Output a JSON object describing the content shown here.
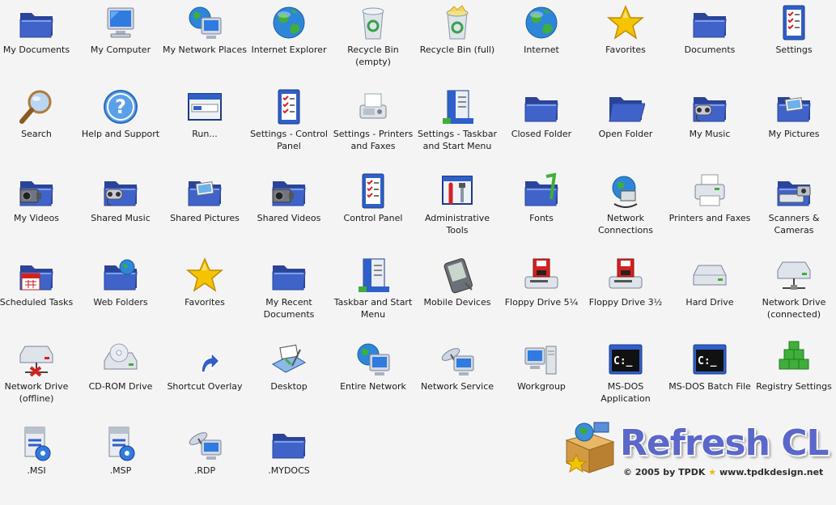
{
  "icons": [
    {
      "label": "My Documents",
      "icon": "folder-icon"
    },
    {
      "label": "My Computer",
      "icon": "monitor-icon"
    },
    {
      "label": "My Network Places",
      "icon": "network-places-icon"
    },
    {
      "label": "Internet Explorer",
      "icon": "globe-icon"
    },
    {
      "label": "Recycle Bin (empty)",
      "icon": "recycle-bin-empty-icon"
    },
    {
      "label": "Recycle Bin (full)",
      "icon": "recycle-bin-full-icon"
    },
    {
      "label": "Internet",
      "icon": "globe-icon"
    },
    {
      "label": "Favorites",
      "icon": "star-icon"
    },
    {
      "label": "Documents",
      "icon": "folder-icon"
    },
    {
      "label": "Settings",
      "icon": "checklist-icon"
    },
    {
      "label": "Search",
      "icon": "magnifier-icon"
    },
    {
      "label": "Help and Support",
      "icon": "help-icon"
    },
    {
      "label": "Run...",
      "icon": "run-window-icon"
    },
    {
      "label": "Settings - Control\nPanel",
      "icon": "checklist-icon"
    },
    {
      "label": "Settings - Printers\nand Faxes",
      "icon": "fax-icon"
    },
    {
      "label": "Settings - Taskbar\nand Start Menu",
      "icon": "taskbar-icon"
    },
    {
      "label": "Closed Folder",
      "icon": "folder-icon"
    },
    {
      "label": "Open Folder",
      "icon": "folder-open-icon"
    },
    {
      "label": "My Music",
      "icon": "music-folder-icon"
    },
    {
      "label": "My Pictures",
      "icon": "pictures-folder-icon"
    },
    {
      "label": "My Videos",
      "icon": "video-folder-icon"
    },
    {
      "label": "Shared Music",
      "icon": "music-folder-icon"
    },
    {
      "label": "Shared Pictures",
      "icon": "pictures-folder-icon"
    },
    {
      "label": "Shared Videos",
      "icon": "video-folder-icon"
    },
    {
      "label": "Control Panel",
      "icon": "checklist-icon"
    },
    {
      "label": "Administrative Tools",
      "icon": "tools-icon"
    },
    {
      "label": "Fonts",
      "icon": "fonts-folder-icon"
    },
    {
      "label": "Network\nConnections",
      "icon": "network-connections-icon"
    },
    {
      "label": "Printers and Faxes",
      "icon": "printer-icon"
    },
    {
      "label": "Scanners &\nCameras",
      "icon": "scanner-icon"
    },
    {
      "label": "Scheduled Tasks",
      "icon": "calendar-folder-icon"
    },
    {
      "label": "Web Folders",
      "icon": "web-folder-icon"
    },
    {
      "label": "Favorites",
      "icon": "star-icon"
    },
    {
      "label": "My Recent\nDocuments",
      "icon": "folder-icon"
    },
    {
      "label": "Taskbar and Start\nMenu",
      "icon": "taskbar-icon"
    },
    {
      "label": "Mobile Devices",
      "icon": "pda-icon"
    },
    {
      "label": "Floppy Drive 5¼",
      "icon": "floppy-drive-icon"
    },
    {
      "label": "Floppy Drive 3½",
      "icon": "floppy-drive-icon"
    },
    {
      "label": "Hard Drive",
      "icon": "hard-drive-icon"
    },
    {
      "label": "Network Drive\n(connected)",
      "icon": "network-drive-icon"
    },
    {
      "label": "Network Drive\n(offline)",
      "icon": "network-drive-offline-icon"
    },
    {
      "label": "CD-ROM Drive",
      "icon": "cdrom-drive-icon"
    },
    {
      "label": "Shortcut Overlay",
      "icon": "shortcut-arrow-icon"
    },
    {
      "label": "Desktop",
      "icon": "desktop-icon"
    },
    {
      "label": "Entire Network",
      "icon": "network-places-icon"
    },
    {
      "label": "Network Service",
      "icon": "network-service-icon"
    },
    {
      "label": "Workgroup",
      "icon": "workgroup-icon"
    },
    {
      "label": "MS-DOS Application",
      "icon": "msdos-icon"
    },
    {
      "label": "MS-DOS Batch File",
      "icon": "msdos-icon"
    },
    {
      "label": "Registry Settings",
      "icon": "registry-icon"
    },
    {
      "label": ".MSI",
      "icon": "msi-icon"
    },
    {
      "label": ".MSP",
      "icon": "msi-icon"
    },
    {
      "label": ".RDP",
      "icon": "network-service-icon"
    },
    {
      "label": ".MYDOCS",
      "icon": "folder-icon"
    }
  ],
  "brand": {
    "title": "Refresh CL",
    "credit_prefix": "© 2005 by TPDK",
    "credit_suffix": "www.tpdkdesign.net"
  },
  "colors": {
    "folder_blue": "#3f63c9",
    "brand_blue": "#5b67c9",
    "star_gold": "#f5c400"
  }
}
